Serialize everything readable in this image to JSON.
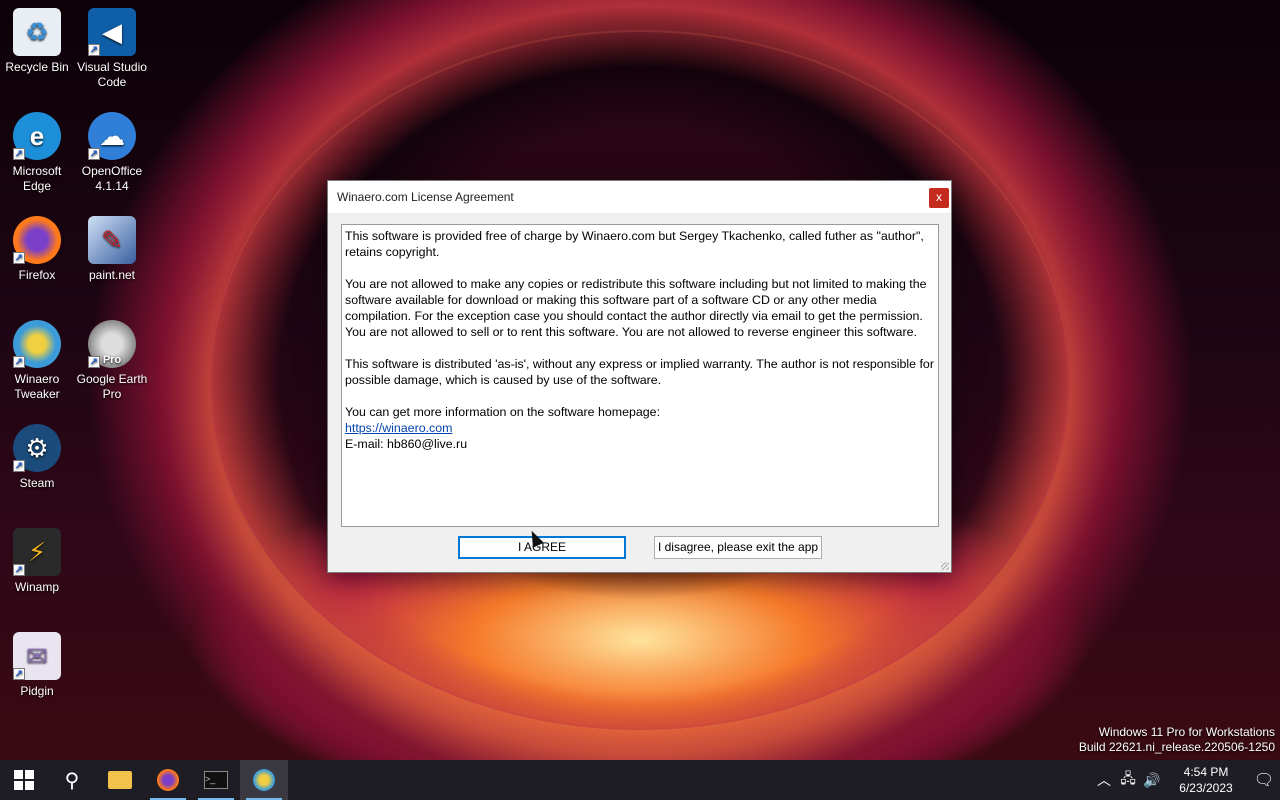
{
  "desktop": {
    "icons": [
      {
        "label": "Recycle Bin",
        "glyph": "♻",
        "color": "#3b8fd4",
        "icon": "recycle-bin-icon"
      },
      {
        "label": "Visual Studio Code",
        "glyph": "◀",
        "color": "#2c8fd6",
        "icon": "vscode-icon"
      },
      {
        "label": "Microsoft Edge",
        "glyph": "e",
        "color": "#1d8fd9",
        "icon": "edge-icon"
      },
      {
        "label": "OpenOffice 4.1.14",
        "glyph": "☁",
        "color": "#2f7fd8",
        "icon": "openoffice-icon"
      },
      {
        "label": "Firefox",
        "glyph": "●",
        "color": "#ff7a1a",
        "icon": "firefox-icon"
      },
      {
        "label": "paint.net",
        "glyph": "✎",
        "color": "#5a7fbf",
        "icon": "paintnet-icon"
      },
      {
        "label": "Winaero Tweaker",
        "glyph": "◎",
        "color": "#3c9bd8",
        "icon": "winaero-tweaker-icon"
      },
      {
        "label": "Google Earth Pro",
        "glyph": "◉",
        "color": "#9a9a9a",
        "icon": "google-earth-icon",
        "badge": "Pro"
      },
      {
        "label": "Steam",
        "glyph": "⚙",
        "color": "#1b4b7a",
        "icon": "steam-icon"
      },
      {
        "label": "Winamp",
        "glyph": "⚡",
        "color": "#d9a21b",
        "icon": "winamp-icon"
      },
      {
        "label": "Pidgin",
        "glyph": "✉",
        "color": "#8a6fb0",
        "icon": "pidgin-icon"
      }
    ]
  },
  "dialog": {
    "title": "Winaero.com License Agreement",
    "close_label": "x",
    "paragraphs": {
      "p1": "This software is provided free of charge by Winaero.com but Sergey Tkachenko, called futher as \"author\", retains copyright.",
      "p2": "You are not allowed to make any copies or redistribute this software including but not limited to making the software available for download or making this software part of a software CD or any other media compilation. For the exception case you should contact the author directly via email to get the permission.",
      "p3": "You are not allowed to sell or to rent this software. You are not allowed to reverse engineer this software.",
      "p4": "This software is distributed 'as-is', without any express or implied warranty. The author is not responsible for possible damage, which is caused by use of the software.",
      "p5": "You can get more information on the software homepage:",
      "link": "https://winaero.com",
      "email": "E-mail: hb860@live.ru"
    },
    "agree_label": "I AGREE",
    "disagree_label": "I disagree, please exit the app"
  },
  "watermark": {
    "line1": "Windows 11 Pro for Workstations",
    "line2": "Build 22621.ni_release.220506-1250"
  },
  "taskbar": {
    "clock_time": "4:54 PM",
    "clock_date": "6/23/2023"
  }
}
